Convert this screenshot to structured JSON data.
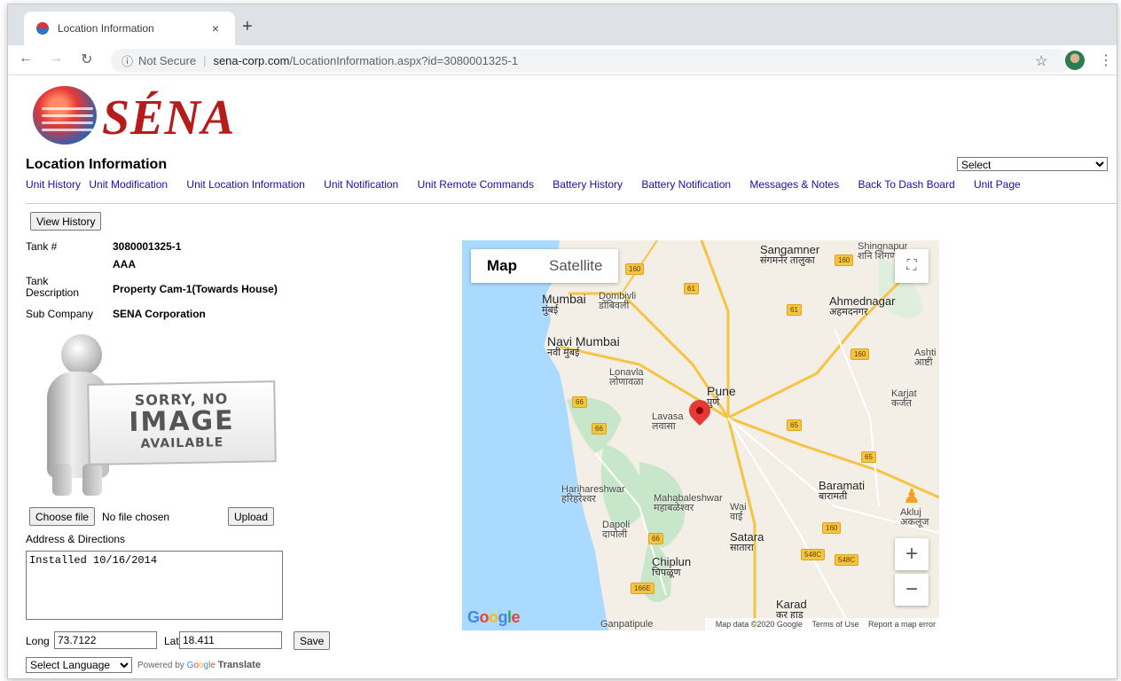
{
  "browser": {
    "tab_title": "Location Information",
    "tab_close": "×",
    "new_tab": "+",
    "security_label": "Not Secure",
    "url_domain": "sena-corp.com",
    "url_path": "/LocationInformation.aspx?id=3080001325-1"
  },
  "brand": {
    "logo_text": "SÉNA"
  },
  "header": {
    "title": "Location Information",
    "select_value": "Select"
  },
  "nav": [
    "Unit History",
    "Unit Modification",
    "Unit Location Information",
    "Unit Notification",
    "Unit Remote Commands",
    "Battery History",
    "Battery Notification",
    "Messages & Notes",
    "Back To Dash Board",
    "Unit Page"
  ],
  "details": {
    "view_history_label": "View History",
    "tank_label": "Tank #",
    "tank_value": "3080001325-1",
    "tank_code": "AAA",
    "description_label": "Tank Description",
    "description_value": "Property Cam-1(Towards House)",
    "sub_company_label": "Sub Company",
    "sub_company_value": "SENA Corporation"
  },
  "placeholder_image": {
    "line1": "SORRY, NO",
    "line2": "IMAGE",
    "line3": "AVAILABLE"
  },
  "upload": {
    "choose_label": "Choose file",
    "no_file_text": "No file chosen",
    "upload_label": "Upload"
  },
  "address": {
    "label": "Address & Directions",
    "value": "Installed 10/16/2014"
  },
  "coords": {
    "long_label": "Long",
    "long_value": "73.7122",
    "lat_label": "Lat",
    "lat_value": "18.411",
    "save_label": "Save"
  },
  "translate": {
    "select_value": "Select Language",
    "powered_by": "Powered by",
    "translate_word": "Translate"
  },
  "map": {
    "type_map": "Map",
    "type_satellite": "Satellite",
    "zoom_in": "+",
    "zoom_out": "−",
    "attribution_data": "Map data ©2020 Google",
    "terms": "Terms of Use",
    "report": "Report a map error",
    "google_letters": [
      "G",
      "o",
      "o",
      "g",
      "l",
      "e"
    ],
    "cities": [
      {
        "name": "Sangamner",
        "dev": "संगमनेर तालुका"
      },
      {
        "name": "Shingnapur",
        "dev": "शनि शिंगणापूर"
      },
      {
        "name": "Mumbai",
        "dev": "मुंबई"
      },
      {
        "name": "Dombivli",
        "dev": "डोंबिवली"
      },
      {
        "name": "Ahmednagar",
        "dev": "अहमदनगर"
      },
      {
        "name": "Navi Mumbai",
        "dev": "नवी मुंबई"
      },
      {
        "name": "Lonavla",
        "dev": "लोणावळा"
      },
      {
        "name": "Pune",
        "dev": "पुणे"
      },
      {
        "name": "Karjat",
        "dev": "कर्जत"
      },
      {
        "name": "Ashti",
        "dev": "आष्टी"
      },
      {
        "name": "Lavasa",
        "dev": "लवासा"
      },
      {
        "name": "Baramati",
        "dev": "बारामती"
      },
      {
        "name": "Harihareshwar",
        "dev": "हरिहरेश्वर"
      },
      {
        "name": "Mahabaleshwar",
        "dev": "महाबळेश्वर"
      },
      {
        "name": "Wai",
        "dev": "वाई"
      },
      {
        "name": "Akluj",
        "dev": "अकलूज"
      },
      {
        "name": "Dapoli",
        "dev": "दापोली"
      },
      {
        "name": "Satara",
        "dev": "सातारा"
      },
      {
        "name": "Chiplun",
        "dev": "चिपळूण"
      },
      {
        "name": "Karad",
        "dev": "कर हाड"
      },
      {
        "name": "Ganpatipule",
        "dev": ""
      }
    ],
    "shields": [
      "160",
      "160",
      "61",
      "61",
      "160",
      "66",
      "66",
      "65",
      "65",
      "160",
      "66",
      "548C",
      "548C",
      "166E"
    ],
    "colors": {
      "water": "#aadaff",
      "land": "#f3efe6",
      "forest": "#c8e6c9",
      "road": "#f6c343",
      "pin": "#e53935"
    }
  }
}
